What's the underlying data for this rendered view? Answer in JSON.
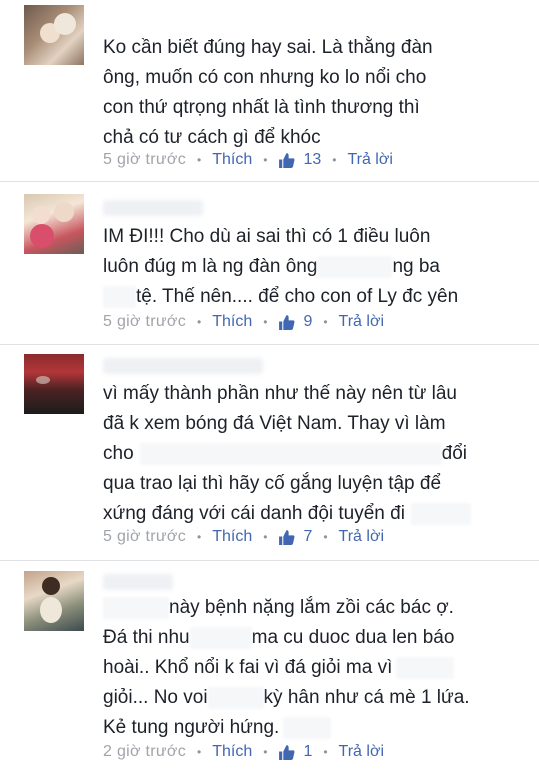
{
  "comments": [
    {
      "lines": [
        [
          "Ko cần biết đúng hay sai. Là thằng đàn"
        ],
        [
          "ông, muốn có con nhưng ko lo nổi cho"
        ],
        [
          "con thứ qtrọng nhất là tình thương thì"
        ],
        [
          "chả có tư cách gì để khóc"
        ]
      ],
      "time": "5 giờ trước",
      "like_label": "Thích",
      "like_count": "13",
      "reply_label": "Trả lời"
    },
    {
      "lines": [
        [
          "IM ĐI!!! Cho dù ai sai thì có 1 điều luôn"
        ],
        [
          "luôn đúg m là ng đàn ông",
          "ng ba"
        ],
        [
          "tệ. Thế nên.... để cho con of Ly đc yên"
        ]
      ],
      "time": "5 giờ trước",
      "like_label": "Thích",
      "like_count": "9",
      "reply_label": "Trả lời"
    },
    {
      "lines": [
        [
          "vì mấy thành phần như thế này nên từ lâu"
        ],
        [
          "đã k xem bóng đá Việt Nam. Thay vì làm"
        ],
        [
          "cho",
          "đổi"
        ],
        [
          "qua trao lại thì hãy cố gắng luyện tập để"
        ],
        [
          "xứng đáng với cái danh đội tuyển đi"
        ]
      ],
      "time": "5 giờ trước",
      "like_label": "Thích",
      "like_count": "7",
      "reply_label": "Trả lời"
    },
    {
      "lines": [
        [
          "này bệnh nặng lắm zồi các bác ợ."
        ],
        [
          "Đá thi nhu",
          "ma cu duoc dua len báo"
        ],
        [
          "hoài.. Khổ nổi k fai vì đá giỏi ma vì"
        ],
        [
          "giỏi... No voi",
          "kỳ hân như cá mè 1 lứa."
        ],
        [
          "Kẻ tung người hứng."
        ]
      ],
      "time": "2 giờ trước",
      "like_label": "Thích",
      "like_count": "1",
      "reply_label": "Trả lời"
    }
  ]
}
